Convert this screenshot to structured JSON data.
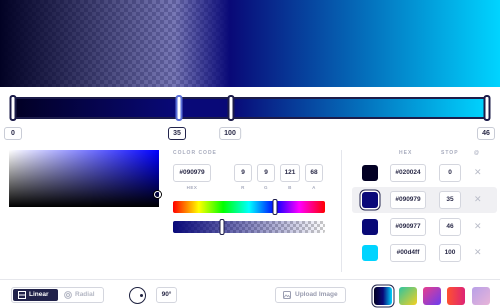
{
  "editor": {
    "gradient_css": "linear-gradient(90deg, #020024 0%, #090979 35%, #090977 46%, #00d4ff 100%)",
    "stops": [
      {
        "hex": "#020024",
        "stop": "0",
        "color": "#020024",
        "selected": false
      },
      {
        "hex": "#090979",
        "stop": "35",
        "color": "#090979",
        "selected": true
      },
      {
        "hex": "#090977",
        "stop": "46",
        "color": "#090977",
        "selected": false
      },
      {
        "hex": "#00d4ff",
        "stop": "100",
        "color": "#00d4ff",
        "selected": false
      }
    ]
  },
  "slider": {
    "labels": [
      "0",
      "35",
      "100",
      "46"
    ],
    "active_label": "35"
  },
  "color_code": {
    "title": "COLOR CODE",
    "hex_value": "#090979",
    "hex_caption": "HEX",
    "r": "9",
    "g": "9",
    "b": "121",
    "a": "68",
    "r_caption": "R",
    "g_caption": "G",
    "b_caption": "B",
    "a_caption": "A",
    "hue_fraction": 0.67,
    "alpha_fraction": 0.32
  },
  "stop_list": {
    "header_hex": "HEX",
    "header_stop": "STOP",
    "header_symbol": "@",
    "delete_glyph": "✕"
  },
  "bottom": {
    "linear_label": "Linear",
    "radial_label": "Radial",
    "angle_value": "90°",
    "upload_label": "Upload Image",
    "presets": [
      {
        "name": "preset-current",
        "css": "linear-gradient(90deg, #020024, #090979, #00d4ff)",
        "active": true
      },
      {
        "name": "preset-yellow-teal",
        "css": "linear-gradient(135deg, #2fc4a0, #f5d020)",
        "active": false
      },
      {
        "name": "preset-purple-pink",
        "css": "linear-gradient(135deg, #e83e8c, #6a3df0)",
        "active": false
      },
      {
        "name": "preset-orange-red",
        "css": "linear-gradient(90deg, #ff512f, #dd2476)",
        "active": false
      },
      {
        "name": "preset-lavender",
        "css": "linear-gradient(135deg, #b8a0e8, #e8b4d8)",
        "active": false
      }
    ]
  }
}
